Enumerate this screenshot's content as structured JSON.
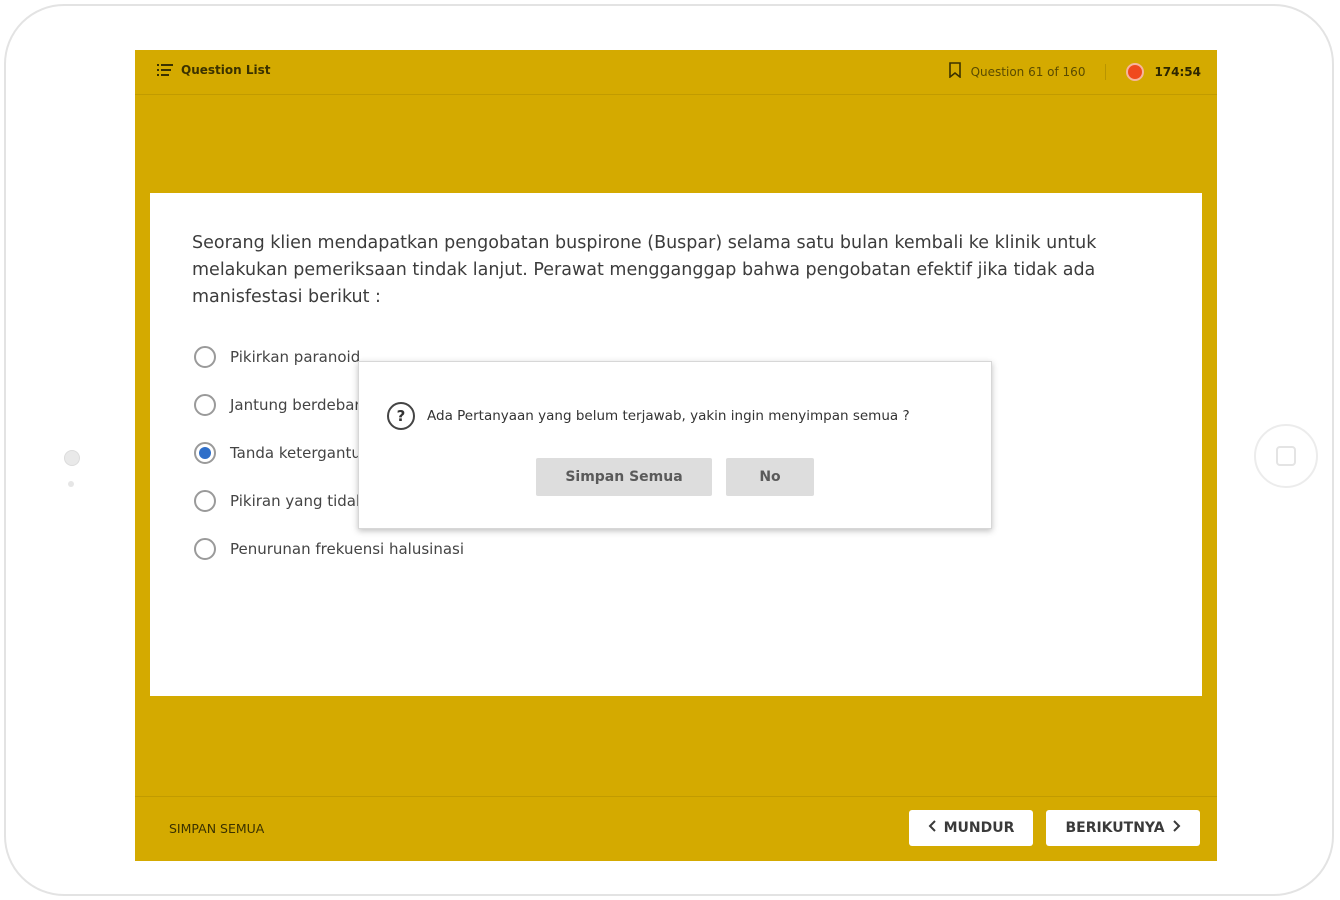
{
  "header": {
    "question_list_label": "Question List",
    "question_counter": "Question 61 of 160",
    "timer": "174:54"
  },
  "question": {
    "text": "Seorang klien mendapatkan pengobatan buspirone (Buspar) selama satu bulan kembali ke klinik untuk melakukan pemeriksaan tindak lanjut. Perawat mengganggap bahwa pengobatan efektif jika tidak ada manisfestasi berikut :",
    "options": [
      {
        "label": "Pikirkan paranoid",
        "selected": false
      },
      {
        "label": "Jantung berdebar",
        "selected": false
      },
      {
        "label": "Tanda ketergantungan",
        "selected": true
      },
      {
        "label": "Pikiran yang tidak terkendali",
        "selected": false
      },
      {
        "label": "Penurunan frekuensi halusinasi",
        "selected": false
      }
    ]
  },
  "footer": {
    "save_all_label": "SIMPAN SEMUA",
    "prev_label": "MUNDUR",
    "next_label": "BERIKUTNYA"
  },
  "dialog": {
    "message": "Ada Pertanyaan yang belum terjawab, yakin ingin menyimpan semua ?",
    "confirm_label": "Simpan Semua",
    "cancel_label": "No",
    "icon_glyph": "?"
  },
  "colors": {
    "accent": "#d4aa00",
    "timer_dot": "#f04a1e",
    "selected_radio": "#2f6fc9"
  }
}
